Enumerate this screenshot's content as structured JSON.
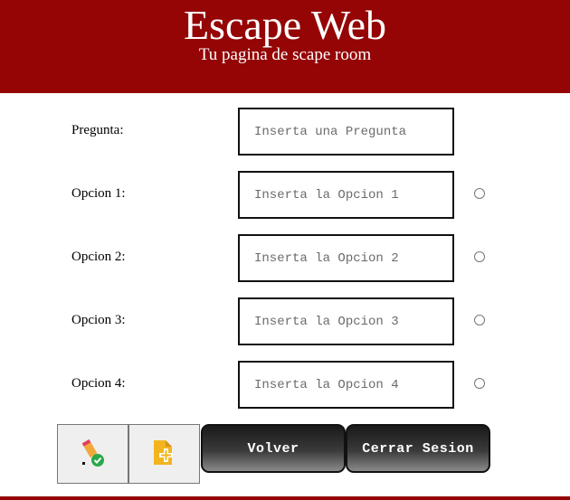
{
  "header": {
    "title": "Escape Web",
    "subtitle": "Tu pagina de scape room"
  },
  "form": {
    "question": {
      "label": "Pregunta:",
      "placeholder": "Inserta una Pregunta",
      "value": ""
    },
    "options": [
      {
        "label": "Opcion 1:",
        "placeholder": "Inserta la Opcion 1",
        "value": "",
        "selected": false
      },
      {
        "label": "Opcion 2:",
        "placeholder": "Inserta la Opcion 2",
        "value": "",
        "selected": false
      },
      {
        "label": "Opcion 3:",
        "placeholder": "Inserta la Opcion 3",
        "value": "",
        "selected": false
      },
      {
        "label": "Opcion 4:",
        "placeholder": "Inserta la Opcion 4",
        "value": "",
        "selected": false
      }
    ]
  },
  "toolbar": {
    "edit_icon": "edit-check-icon",
    "add_icon": "add-file-icon",
    "back_label": "Volver",
    "logout_label": "Cerrar Sesion"
  },
  "colors": {
    "brand": "#950505",
    "button_dark": "#1a1a1a"
  }
}
